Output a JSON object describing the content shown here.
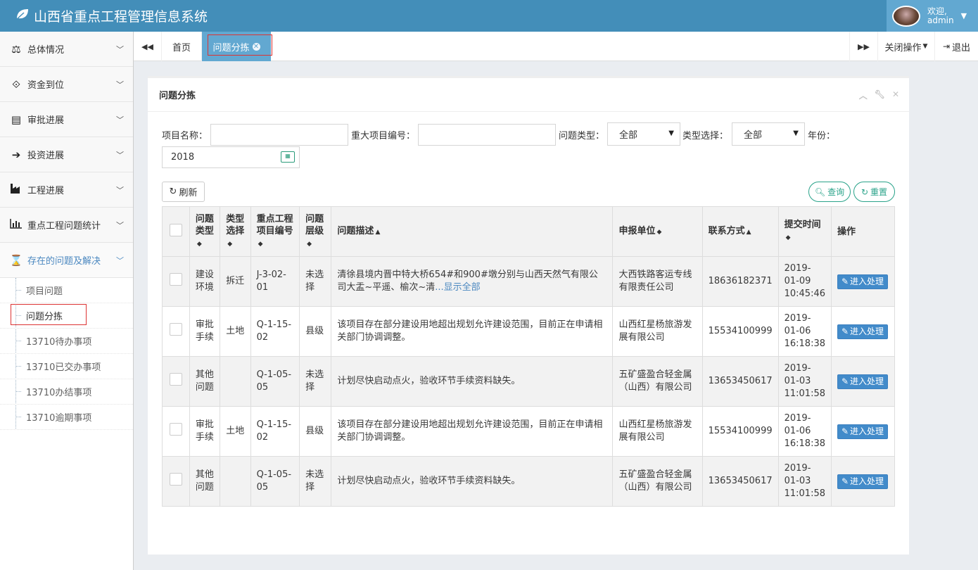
{
  "app": {
    "title": "山西省重点工程管理信息系统",
    "welcome": "欢迎,",
    "user": "admin"
  },
  "sidebar": {
    "items": [
      {
        "label": "总体情况",
        "icon": "balance-scale-icon"
      },
      {
        "label": "资金到位",
        "icon": "handshake-icon"
      },
      {
        "label": "审批进展",
        "icon": "newspaper-icon"
      },
      {
        "label": "投资进展",
        "icon": "sign-in-icon"
      },
      {
        "label": "工程进展",
        "icon": "industry-icon"
      },
      {
        "label": "重点工程问题统计",
        "icon": "bar-chart-icon"
      },
      {
        "label": "存在的问题及解决",
        "icon": "hourglass-icon"
      }
    ],
    "subitems": [
      "项目问题",
      "问题分拣",
      "13710待办事项",
      "13710已交办事项",
      "13710办结事项",
      "13710逾期事项"
    ]
  },
  "tabbar": {
    "home": "首页",
    "active_tab": "问题分拣",
    "close_ops": "关闭操作",
    "logout": "退出"
  },
  "panel": {
    "title": "问题分拣"
  },
  "filters": {
    "project_name_label": "项目名称：",
    "project_no_label": "重大项目编号：",
    "problem_type_label": "问题类型：",
    "problem_type_value": "全部",
    "type_select_label": "类型选择：",
    "type_select_value": "全部",
    "year_label": "年份：",
    "year_value": "2018"
  },
  "buttons": {
    "refresh": "刷新",
    "query": "查询",
    "reset": "重置",
    "process": "进入处理"
  },
  "table": {
    "headers": [
      "问题类型",
      "类型选择",
      "重点工程项目编号",
      "问题层级",
      "问题描述",
      "申报单位",
      "联系方式",
      "提交时间",
      "操作"
    ],
    "rows": [
      {
        "type": "建设环境",
        "select": "拆迁",
        "code": "J-3-02-01",
        "level": "未选择",
        "desc": "清徐县境内晋中特大桥654#和900#墩分别与山西天然气有限公司大盂~平遥、榆次~清",
        "more": "...显示全部",
        "unit": "大西铁路客运专线有限责任公司",
        "phone": "18636182371",
        "time": "2019-01-09 10:45:46"
      },
      {
        "type": "审批手续",
        "select": "土地",
        "code": "Q-1-15-02",
        "level": "县级",
        "desc": "该项目存在部分建设用地超出规划允许建设范围，目前正在申请相关部门协调调整。",
        "more": "",
        "unit": "山西红星杨旅游发展有限公司",
        "phone": "15534100999",
        "time": "2019-01-06 16:18:38"
      },
      {
        "type": "其他问题",
        "select": "",
        "code": "Q-1-05-05",
        "level": "未选择",
        "desc": "计划尽快启动点火，验收环节手续资料缺失。",
        "more": "",
        "unit": "五矿盛盈合轻金属（山西）有限公司",
        "phone": "13653450617",
        "time": "2019-01-03 11:01:58"
      },
      {
        "type": "审批手续",
        "select": "土地",
        "code": "Q-1-15-02",
        "level": "县级",
        "desc": "该项目存在部分建设用地超出规划允许建设范围，目前正在申请相关部门协调调整。",
        "more": "",
        "unit": "山西红星杨旅游发展有限公司",
        "phone": "15534100999",
        "time": "2019-01-06 16:18:38"
      },
      {
        "type": "其他问题",
        "select": "",
        "code": "Q-1-05-05",
        "level": "未选择",
        "desc": "计划尽快启动点火，验收环节手续资料缺失。",
        "more": "",
        "unit": "五矿盛盈合轻金属（山西）有限公司",
        "phone": "13653450617",
        "time": "2019-01-03 11:01:58"
      }
    ]
  }
}
